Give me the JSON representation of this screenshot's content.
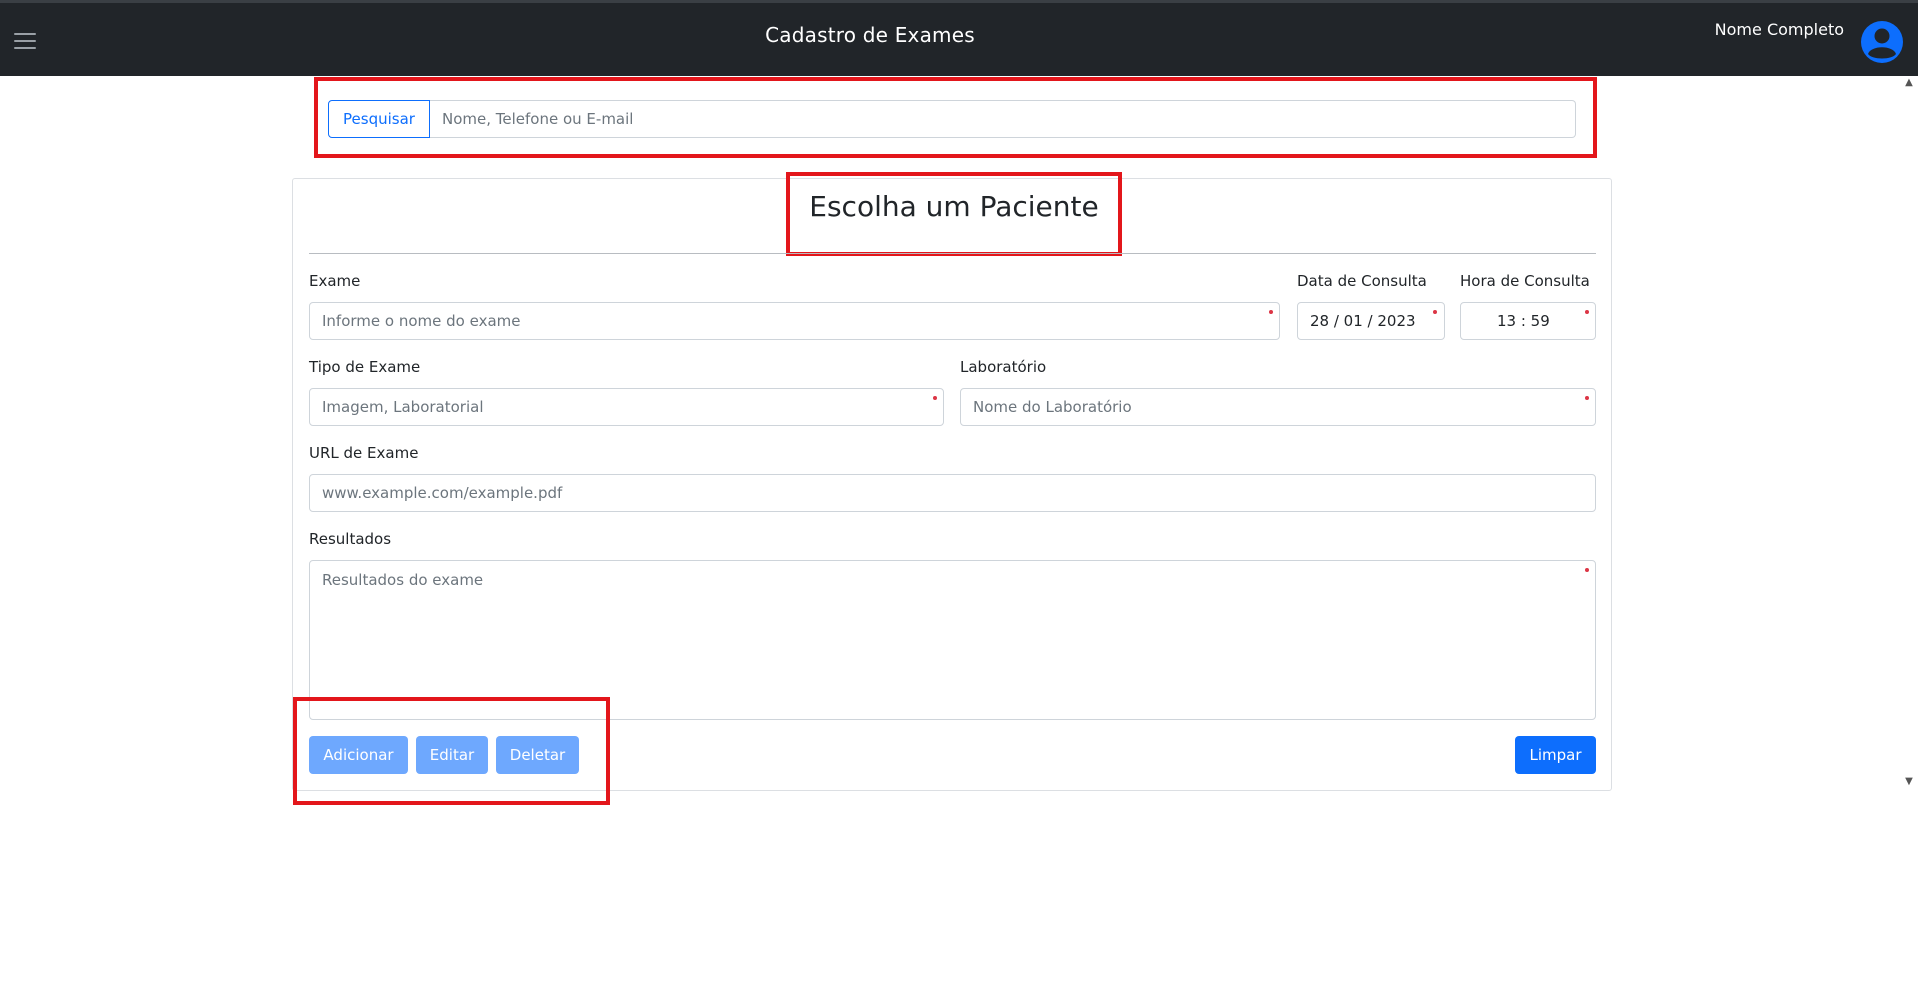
{
  "header": {
    "title": "Cadastro de Exames",
    "user_name": "Nome Completo"
  },
  "search": {
    "button_label": "Pesquisar",
    "placeholder": "Nome, Telefone ou E-mail"
  },
  "form": {
    "title": "Escolha um Paciente",
    "exame": {
      "label": "Exame",
      "placeholder": "Informe o nome do exame"
    },
    "data_consulta": {
      "label": "Data de Consulta",
      "value": "28 / 01 / 2023"
    },
    "hora_consulta": {
      "label": "Hora de Consulta",
      "value": "13 : 59"
    },
    "tipo_exame": {
      "label": "Tipo de Exame",
      "placeholder": "Imagem, Laboratorial"
    },
    "laboratorio": {
      "label": "Laboratório",
      "placeholder": "Nome do Laboratório"
    },
    "url_exame": {
      "label": "URL de Exame",
      "placeholder": "www.example.com/example.pdf"
    },
    "resultados": {
      "label": "Resultados",
      "placeholder": "Resultados do exame"
    }
  },
  "actions": {
    "add_label": "Adicionar",
    "edit_label": "Editar",
    "delete_label": "Deletar",
    "clear_label": "Limpar"
  },
  "colors": {
    "navbar": "#212529",
    "primary": "#0d6efd",
    "primary_disabled": "#6ea8fe",
    "highlight": "#e3161b",
    "required_marker": "#dc3545"
  },
  "icons": {
    "menu": "hamburger-icon",
    "avatar": "user-circle-icon"
  }
}
